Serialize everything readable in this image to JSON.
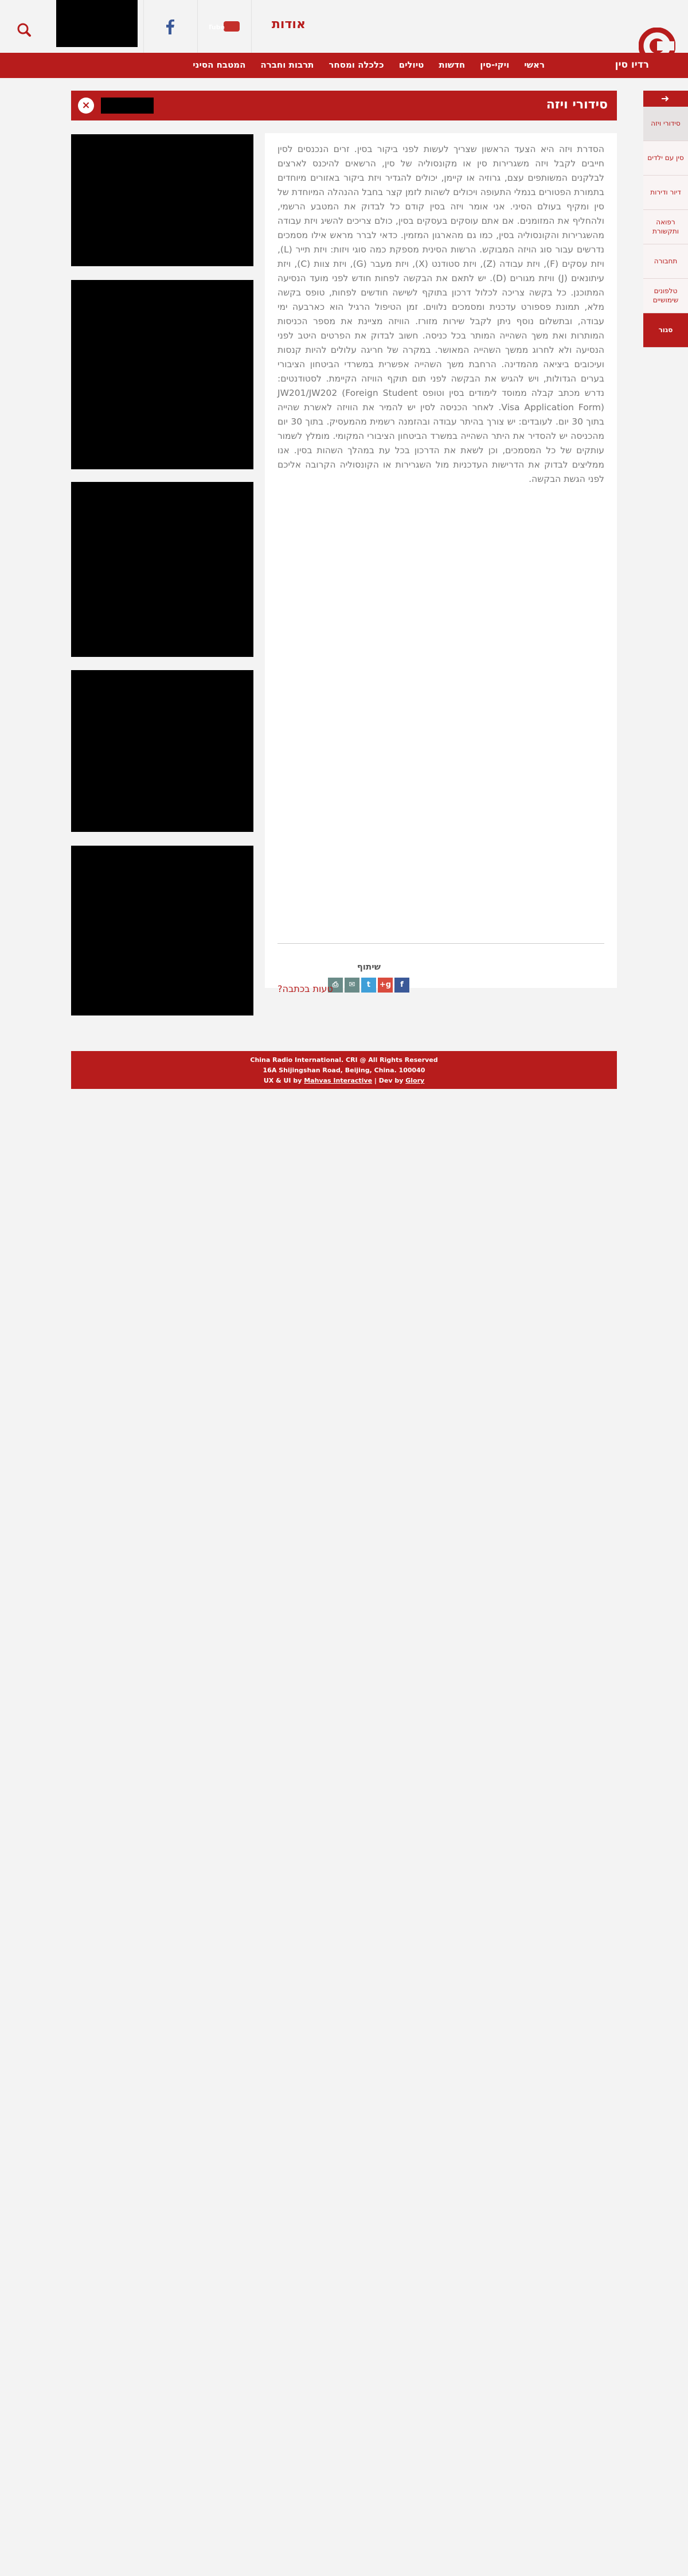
{
  "header": {
    "about_label": "אודות",
    "youtube_label": "YouTube"
  },
  "nav": {
    "brand": "רדיו סין",
    "items": [
      "ראשי",
      "ויקי-סין",
      "חדשות",
      "טיולים",
      "כלכלה ומסחר",
      "תרבות וחברה",
      "המטבח הסיני"
    ]
  },
  "side": {
    "items": [
      "סידורי ויזה",
      "סין עם ילדים",
      "דיור ודירות",
      "רפואה ותקשורת",
      "תחבורה",
      "טלפונים שימושיים"
    ],
    "close_label": "סגור"
  },
  "page": {
    "title": "סידורי ויזה",
    "close_icon": "×",
    "body": "הסדרת ויזה היא הצעד הראשון שצריך לעשות לפני ביקור בסין. זרים הנכנסים לסין חייבים לקבל ויזה משגרירות סין או מקונסוליה של סין, הרשאים להיכנס לארצים לבלקנים המשותפים עצם, גרוזיה או קיימן, יכולים להגדיר ויזת ביקור באזורים מיוחדים בתמורת הפטורים בנמלי התעופה ויכולים לשהות לזמן קצר בחבל ההנהלה המיוחדת של סין ומקיף בעולם הסיני. אני אומר ויזה בסין קודם כל לבדוק את המטבע הרשמי, ולהחליף את המזומנים. אם אתם עוסקים בעסקים בסין, כולם צריכים להשיג ויזת עבודה מהשגרירות והקונסוליה בסין, כמו גם מהארגון המזמין. כדאי לברר מראש אילו מסמכים נדרשים עבור סוג הויזה המבוקש. הרשות הסינית מספקת כמה סוגי ויזות: ויזת תייר (L), ויזת עסקים (F), ויזת עבודה (Z), ויזת סטודנט (X), ויזת מעבר (G), ויזת צוות (C), ויזת עיתונאים (J) וויזת מגורים (D). יש לתאם את הבקשה לפחות חודש לפני מועד הנסיעה המתוכנן. כל בקשה צריכה לכלול דרכון בתוקף לשישה חודשים לפחות, טופס בקשה מלא, תמונת פספורט עדכנית ומסמכים נלווים. זמן הטיפול הרגיל הוא כארבעה ימי עבודה, ובתשלום נוסף ניתן לקבל שירות מזורז. הוויזה מציינת את מספר הכניסות המותרות ואת משך השהייה המותר בכל כניסה. חשוב לבדוק את הפרטים היטב לפני הנסיעה ולא לחרוג ממשך השהייה המאושר. במקרה של חריגה עלולים להיות קנסות ועיכובים ביציאה מהמדינה. הרחבת משך השהייה אפשרית במשרדי הביטחון הציבורי בערים הגדולות, ויש להגיש את הבקשה לפני תום תוקף הוויזה הקיימת. לסטודנטים: נדרש מכתב קבלה ממוסד לימודים בסין וטופס JW201/JW202 (Foreign Student Visa Application Form). לאחר הכניסה לסין יש להמיר את הוויזה לאשרת שהייה בתוך 30 יום. לעובדים: יש צורך בהיתר עבודה ובהזמנה רשמית מהמעסיק. בתוך 30 יום מהכניסה יש להסדיר את היתר השהייה במשרד הביטחון הציבורי המקומי. מומלץ לשמור עותקים של כל המסמכים, וכן לשאת את הדרכון בכל עת במהלך השהות בסין. אנו ממליצים לבדוק את הדרישות העדכניות מול השגרירות או הקונסוליה הקרובה אליכם לפני הגשת הבקשה."
  },
  "share": {
    "label": "שיתוף",
    "icons": [
      "print-icon",
      "mail-icon",
      "twitter-icon",
      "google-plus-icon",
      "facebook-icon"
    ],
    "icon_glyphs": [
      "⎙",
      "✉",
      "t",
      "g+",
      "f"
    ],
    "icon_colors": [
      "#6a8b88",
      "#6a8b88",
      "#3f9fd8",
      "#d94b3d",
      "#3b5998"
    ]
  },
  "mistake_link": "טעות בכתבה?",
  "footer": {
    "line1": "China Radio International. CRI @ All Rights Reserved",
    "line2": "16A Shijingshan Road, Beijing, China. 100040",
    "line3_prefix": "UX & UI by ",
    "line3_ux": "Mahvas Interactive",
    "line3_mid": " | Dev by ",
    "line3_dev": "Glory"
  }
}
